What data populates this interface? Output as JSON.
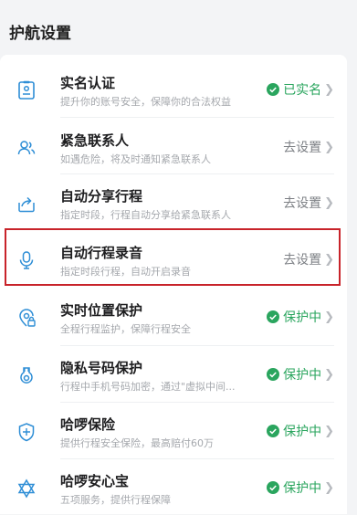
{
  "page": {
    "title": "护航设置"
  },
  "colors": {
    "accent": "#2e8ed6",
    "success": "#2aa55e",
    "highlight": "#c8232a"
  },
  "items": [
    {
      "icon": "id-card-icon",
      "title": "实名认证",
      "subtitle": "提升你的账号安全，保障你的合法权益",
      "status": "已实名",
      "verified": true
    },
    {
      "icon": "contacts-icon",
      "title": "紧急联系人",
      "subtitle": "如遇危险，将及时通知紧急联系人",
      "status": "去设置",
      "verified": false
    },
    {
      "icon": "share-icon",
      "title": "自动分享行程",
      "subtitle": "指定时段，行程自动分享给紧急联系人",
      "status": "去设置",
      "verified": false
    },
    {
      "icon": "microphone-icon",
      "title": "自动行程录音",
      "subtitle": "指定时段行程，自动开启录音",
      "status": "去设置",
      "verified": false
    },
    {
      "icon": "location-lock-icon",
      "title": "实时位置保护",
      "subtitle": "全程行程监护，保障行程安全",
      "status": "保护中",
      "verified": true
    },
    {
      "icon": "phone-privacy-icon",
      "title": "隐私号码保护",
      "subtitle": "行程中手机号码加密，通过\"虚拟中间...",
      "status": "保护中",
      "verified": true
    },
    {
      "icon": "shield-icon",
      "title": "哈啰保险",
      "subtitle": "提供行程安全保险，最高赔付60万",
      "status": "保护中",
      "verified": true
    },
    {
      "icon": "star-of-david-icon",
      "title": "哈啰安心宝",
      "subtitle": "五项服务，提供行程保障",
      "status": "保护中",
      "verified": true
    }
  ]
}
